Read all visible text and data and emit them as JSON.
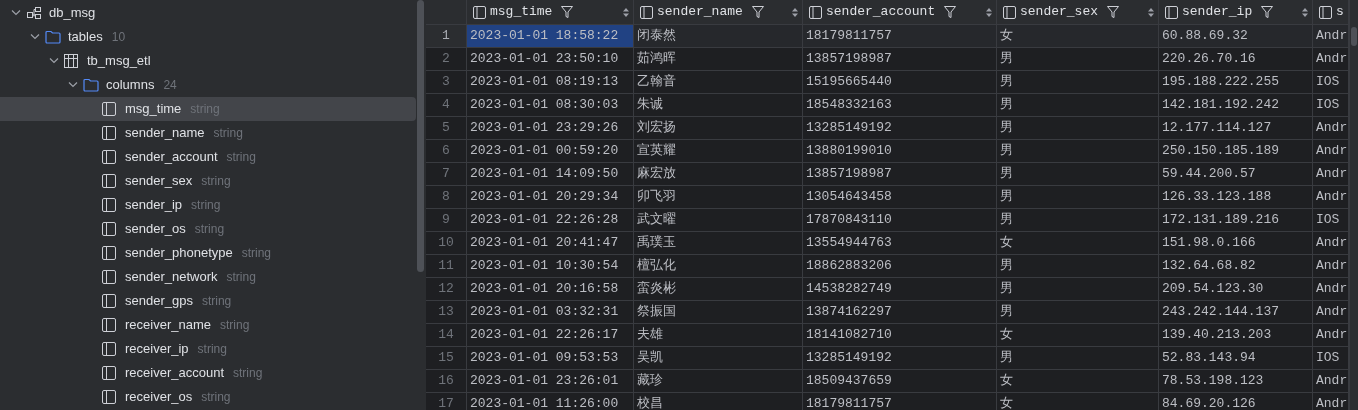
{
  "tree": [
    {
      "kind": "schema",
      "label": "db_msg",
      "expanded": true,
      "children": [
        {
          "kind": "folder",
          "label": "tables",
          "count": "10",
          "expanded": true,
          "children": [
            {
              "kind": "table",
              "label": "tb_msg_etl",
              "expanded": true,
              "children": [
                {
                  "kind": "folder",
                  "label": "columns",
                  "count": "24",
                  "expanded": true,
                  "children": [
                    {
                      "kind": "column",
                      "label": "msg_time",
                      "type": "string",
                      "selected": true
                    },
                    {
                      "kind": "column",
                      "label": "sender_name",
                      "type": "string",
                      "selected": false
                    },
                    {
                      "kind": "column",
                      "label": "sender_account",
                      "type": "string",
                      "selected": false
                    },
                    {
                      "kind": "column",
                      "label": "sender_sex",
                      "type": "string",
                      "selected": false
                    },
                    {
                      "kind": "column",
                      "label": "sender_ip",
                      "type": "string",
                      "selected": false
                    },
                    {
                      "kind": "column",
                      "label": "sender_os",
                      "type": "string",
                      "selected": false
                    },
                    {
                      "kind": "column",
                      "label": "sender_phonetype",
                      "type": "string",
                      "selected": false
                    },
                    {
                      "kind": "column",
                      "label": "sender_network",
                      "type": "string",
                      "selected": false
                    },
                    {
                      "kind": "column",
                      "label": "sender_gps",
                      "type": "string",
                      "selected": false
                    },
                    {
                      "kind": "column",
                      "label": "receiver_name",
                      "type": "string",
                      "selected": false
                    },
                    {
                      "kind": "column",
                      "label": "receiver_ip",
                      "type": "string",
                      "selected": false
                    },
                    {
                      "kind": "column",
                      "label": "receiver_account",
                      "type": "string",
                      "selected": false
                    },
                    {
                      "kind": "column",
                      "label": "receiver_os",
                      "type": "string",
                      "selected": false
                    }
                  ]
                }
              ]
            }
          ]
        }
      ]
    }
  ],
  "table": {
    "columns": [
      "msg_time",
      "sender_name",
      "sender_account",
      "sender_sex",
      "sender_ip",
      "s"
    ],
    "rows": [
      {
        "number": "1",
        "cells": [
          {
            "text": "2023-01-01 18:58:22",
            "selected": true
          },
          {
            "text": "闭泰然",
            "selected": false
          },
          {
            "text": "18179811757",
            "selected": false
          },
          {
            "text": "女",
            "selected": false
          },
          {
            "text": "60.88.69.32",
            "selected": false
          },
          {
            "text": "Andr",
            "selected": false
          }
        ]
      },
      {
        "number": "2",
        "cells": [
          {
            "text": "2023-01-01 23:50:10",
            "selected": false
          },
          {
            "text": "茹鸿晖",
            "selected": false
          },
          {
            "text": "13857198987",
            "selected": false
          },
          {
            "text": "男",
            "selected": false
          },
          {
            "text": "220.26.70.16",
            "selected": false
          },
          {
            "text": "Andr",
            "selected": false
          }
        ]
      },
      {
        "number": "3",
        "cells": [
          {
            "text": "2023-01-01 08:19:13",
            "selected": false
          },
          {
            "text": "乙翰音",
            "selected": false
          },
          {
            "text": "15195665440",
            "selected": false
          },
          {
            "text": "男",
            "selected": false
          },
          {
            "text": "195.188.222.255",
            "selected": false
          },
          {
            "text": "IOS",
            "selected": false
          }
        ]
      },
      {
        "number": "4",
        "cells": [
          {
            "text": "2023-01-01 08:30:03",
            "selected": false
          },
          {
            "text": "朱诚",
            "selected": false
          },
          {
            "text": "18548332163",
            "selected": false
          },
          {
            "text": "男",
            "selected": false
          },
          {
            "text": "142.181.192.242",
            "selected": false
          },
          {
            "text": "IOS",
            "selected": false
          }
        ]
      },
      {
        "number": "5",
        "cells": [
          {
            "text": "2023-01-01 23:29:26",
            "selected": false
          },
          {
            "text": "刘宏扬",
            "selected": false
          },
          {
            "text": "13285149192",
            "selected": false
          },
          {
            "text": "男",
            "selected": false
          },
          {
            "text": "12.177.114.127",
            "selected": false
          },
          {
            "text": "Andr",
            "selected": false
          }
        ]
      },
      {
        "number": "6",
        "cells": [
          {
            "text": "2023-01-01 00:59:20",
            "selected": false
          },
          {
            "text": "宣英耀",
            "selected": false
          },
          {
            "text": "13880199010",
            "selected": false
          },
          {
            "text": "男",
            "selected": false
          },
          {
            "text": "250.150.185.189",
            "selected": false
          },
          {
            "text": "Andr",
            "selected": false
          }
        ]
      },
      {
        "number": "7",
        "cells": [
          {
            "text": "2023-01-01 14:09:50",
            "selected": false
          },
          {
            "text": "麻宏放",
            "selected": false
          },
          {
            "text": "13857198987",
            "selected": false
          },
          {
            "text": "男",
            "selected": false
          },
          {
            "text": "59.44.200.57",
            "selected": false
          },
          {
            "text": "Andr",
            "selected": false
          }
        ]
      },
      {
        "number": "8",
        "cells": [
          {
            "text": "2023-01-01 20:29:34",
            "selected": false
          },
          {
            "text": "卯飞羽",
            "selected": false
          },
          {
            "text": "13054643458",
            "selected": false
          },
          {
            "text": "男",
            "selected": false
          },
          {
            "text": "126.33.123.188",
            "selected": false
          },
          {
            "text": "Andr",
            "selected": false
          }
        ]
      },
      {
        "number": "9",
        "cells": [
          {
            "text": "2023-01-01 22:26:28",
            "selected": false
          },
          {
            "text": "武文曜",
            "selected": false
          },
          {
            "text": "17870843110",
            "selected": false
          },
          {
            "text": "男",
            "selected": false
          },
          {
            "text": "172.131.189.216",
            "selected": false
          },
          {
            "text": "IOS",
            "selected": false
          }
        ]
      },
      {
        "number": "10",
        "cells": [
          {
            "text": "2023-01-01 20:41:47",
            "selected": false
          },
          {
            "text": "禹璞玉",
            "selected": false
          },
          {
            "text": "13554944763",
            "selected": false
          },
          {
            "text": "女",
            "selected": false
          },
          {
            "text": "151.98.0.166",
            "selected": false
          },
          {
            "text": "Andr",
            "selected": false
          }
        ]
      },
      {
        "number": "11",
        "cells": [
          {
            "text": "2023-01-01 10:30:54",
            "selected": false
          },
          {
            "text": "檀弘化",
            "selected": false
          },
          {
            "text": "18862883206",
            "selected": false
          },
          {
            "text": "男",
            "selected": false
          },
          {
            "text": "132.64.68.82",
            "selected": false
          },
          {
            "text": "Andr",
            "selected": false
          }
        ]
      },
      {
        "number": "12",
        "cells": [
          {
            "text": "2023-01-01 20:16:58",
            "selected": false
          },
          {
            "text": "蛮炎彬",
            "selected": false
          },
          {
            "text": "14538282749",
            "selected": false
          },
          {
            "text": "男",
            "selected": false
          },
          {
            "text": "209.54.123.30",
            "selected": false
          },
          {
            "text": "Andr",
            "selected": false
          }
        ]
      },
      {
        "number": "13",
        "cells": [
          {
            "text": "2023-01-01 03:32:31",
            "selected": false
          },
          {
            "text": "祭振国",
            "selected": false
          },
          {
            "text": "13874162297",
            "selected": false
          },
          {
            "text": "男",
            "selected": false
          },
          {
            "text": "243.242.144.137",
            "selected": false
          },
          {
            "text": "Andr",
            "selected": false
          }
        ]
      },
      {
        "number": "14",
        "cells": [
          {
            "text": "2023-01-01 22:26:17",
            "selected": false
          },
          {
            "text": "夫雄",
            "selected": false
          },
          {
            "text": "18141082710",
            "selected": false
          },
          {
            "text": "女",
            "selected": false
          },
          {
            "text": "139.40.213.203",
            "selected": false
          },
          {
            "text": "Andr",
            "selected": false
          }
        ]
      },
      {
        "number": "15",
        "cells": [
          {
            "text": "2023-01-01 09:53:53",
            "selected": false
          },
          {
            "text": "吴凯",
            "selected": false
          },
          {
            "text": "13285149192",
            "selected": false
          },
          {
            "text": "男",
            "selected": false
          },
          {
            "text": "52.83.143.94",
            "selected": false
          },
          {
            "text": "IOS",
            "selected": false
          }
        ]
      },
      {
        "number": "16",
        "cells": [
          {
            "text": "2023-01-01 23:26:01",
            "selected": false
          },
          {
            "text": "藏珍",
            "selected": false
          },
          {
            "text": "18509437659",
            "selected": false
          },
          {
            "text": "女",
            "selected": false
          },
          {
            "text": "78.53.198.123",
            "selected": false
          },
          {
            "text": "Andr",
            "selected": false
          }
        ]
      },
      {
        "number": "17",
        "cells": [
          {
            "text": "2023-01-01 11:26:00",
            "selected": false
          },
          {
            "text": "校昌",
            "selected": false
          },
          {
            "text": "18179811757",
            "selected": false
          },
          {
            "text": "女",
            "selected": false
          },
          {
            "text": "84.69.20.126",
            "selected": false
          },
          {
            "text": "Andr",
            "selected": false
          }
        ]
      }
    ]
  }
}
